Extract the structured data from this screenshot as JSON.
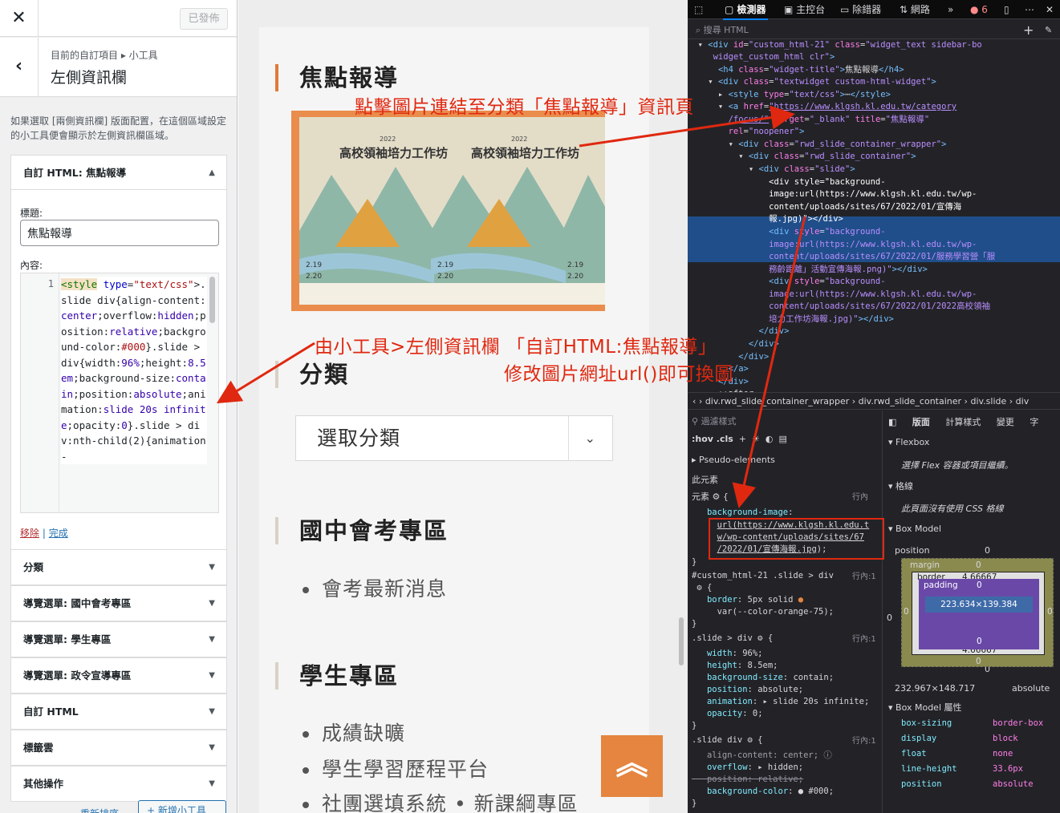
{
  "customizer": {
    "close_icon": "close-icon",
    "publish_label": "已發佈",
    "breadcrumb": "目前的自訂項目 ▸ 小工具",
    "section_title": "左側資訊欄",
    "description": "如果選取 [兩側資訊欄] 版面配置，在這個區域設定的小工具便會顯示於左側資訊欄區域。",
    "open_widget": {
      "header": "自訂 HTML: 焦點報導",
      "title_label": "標題:",
      "title_value": "焦點報導",
      "content_label": "內容:",
      "line_number": "1",
      "remove_label": "移除",
      "separator": "|",
      "done_label": "完成"
    },
    "widgets": [
      "分類",
      "導覽選單: 國中會考專區",
      "導覽選單: 學生專區",
      "導覽選單: 政令宣導專區",
      "自訂 HTML",
      "標籤雲",
      "其他操作"
    ],
    "reorder_label": "重新排序",
    "add_widget_label": "+ 新增小工具"
  },
  "preview": {
    "headings": [
      "焦點報導",
      "分類",
      "國中會考專區",
      "學生專區"
    ],
    "banner": {
      "year": "2022",
      "title": "高校領袖培力工作坊",
      "dates": [
        "2.19",
        "2.20"
      ]
    },
    "category_select": "選取分類",
    "exam_items": [
      "會考最新消息"
    ],
    "student_items": [
      "成績缺曠",
      "學生學習歷程平台",
      "社團選填系統 • 新課綱專區"
    ]
  },
  "devtools": {
    "tabs": [
      "檢測器",
      "主控台",
      "除錯器",
      "網路"
    ],
    "error_count": "6",
    "search_placeholder": "搜尋 HTML",
    "breadcrumb": [
      "div.rwd_slide_container_wrapper",
      "div.rwd_slide_container",
      "div.slide",
      "div"
    ],
    "filter_placeholder": "過濾樣式",
    "hov_cls": ":hov .cls",
    "pseudo_elements": "Pseudo-elements",
    "this_element": "此元素",
    "element_label": "元素",
    "inline_label": "行內",
    "layout_tabs": [
      "版面",
      "計算樣式",
      "變更",
      "字"
    ],
    "flexbox_label": "Flexbox",
    "flexbox_msg": "選擇 Flex 容器或項目繼續。",
    "grid_label": "格線",
    "grid_msg": "此頁面沒有使用 CSS 格線",
    "boxmodel_label": "Box Model",
    "boxmodel_props_label": "Box Model 屬性",
    "position_label": "position",
    "position_value": "0",
    "margin_label": "margin",
    "border_label": "border",
    "padding_label": "padding",
    "content_size": "223.634×139.384",
    "dimensions": "232.967×148.717",
    "position_type": "absolute",
    "border_value": "4.66667",
    "zero": "0",
    "props": [
      {
        "name": "box-sizing",
        "value": "border-box"
      },
      {
        "name": "display",
        "value": "block"
      },
      {
        "name": "float",
        "value": "none"
      },
      {
        "name": "line-height",
        "value": "33.6px"
      },
      {
        "name": "position",
        "value": "absolute"
      }
    ]
  },
  "annotations": {
    "top": "點擊圖片連結至分類「焦點報導」資訊頁",
    "middle": "由小工具>左側資訊欄 「自訂HTML:焦點報導」",
    "bottom": "修改圖片網址url()即可換圖"
  }
}
